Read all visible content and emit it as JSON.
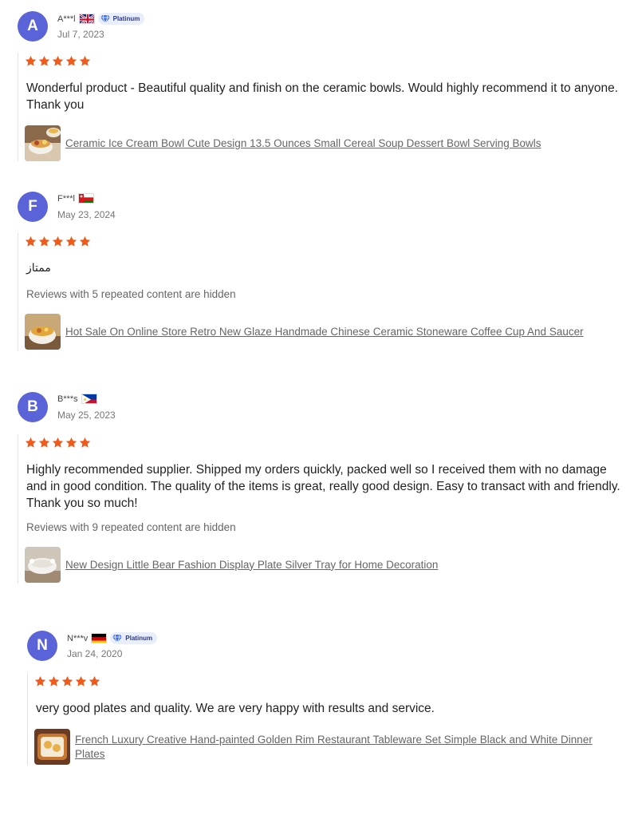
{
  "reviews": [
    {
      "avatar_letter": "A",
      "name": "A***l",
      "country_flag": "uk",
      "badge": "Platinum",
      "date": "Jul 7, 2023",
      "rating": 5,
      "text": "Wonderful product - Beautiful quality and finish on the ceramic bowls. Would highly recommend it to anyone. Thank you",
      "hidden_note": "",
      "product_title": "Ceramic Ice Cream Bowl Cute Design 13.5 Ounces Small Cereal Soup Dessert Bowl Serving Bowls"
    },
    {
      "avatar_letter": "F",
      "name": "F***l",
      "country_flag": "oman",
      "badge": "",
      "date": "May 23, 2024",
      "rating": 5,
      "text": "ممتاز",
      "hidden_note": "Reviews with 5 repeated content are hidden",
      "product_title": "Hot Sale On Online Store Retro New Glaze Handmade Chinese Ceramic Stoneware Coffee Cup And Saucer"
    },
    {
      "avatar_letter": "B",
      "name": "B***s",
      "country_flag": "philippines",
      "badge": "",
      "date": "May 25, 2023",
      "rating": 5,
      "text": "Highly recommended supplier. Shipped my orders quickly, packed well so I received them with no damage and in good condition. The quality of the items is great, really good design. Easy to transact with and friendly. Thank you so much!",
      "hidden_note": "Reviews with 9 repeated content are hidden",
      "product_title": "New Design Little Bear Fashion Display Plate Silver Tray for Home Decoration"
    },
    {
      "avatar_letter": "N",
      "name": "N***v",
      "country_flag": "germany",
      "badge": "Platinum",
      "date": "Jan 24, 2020",
      "rating": 5,
      "text": "very good plates and quality. We are very happy with results and service.",
      "hidden_note": "",
      "product_title": "French Luxury Creative Hand-painted Golden Rim Restaurant Tableware Set Simple Black and White Dinner Plates"
    }
  ],
  "colors": {
    "avatar": "#5a63d8",
    "star": "#f05a1a",
    "badge_bg": "#e9eefc",
    "badge_icon": "#3f6ee8"
  }
}
